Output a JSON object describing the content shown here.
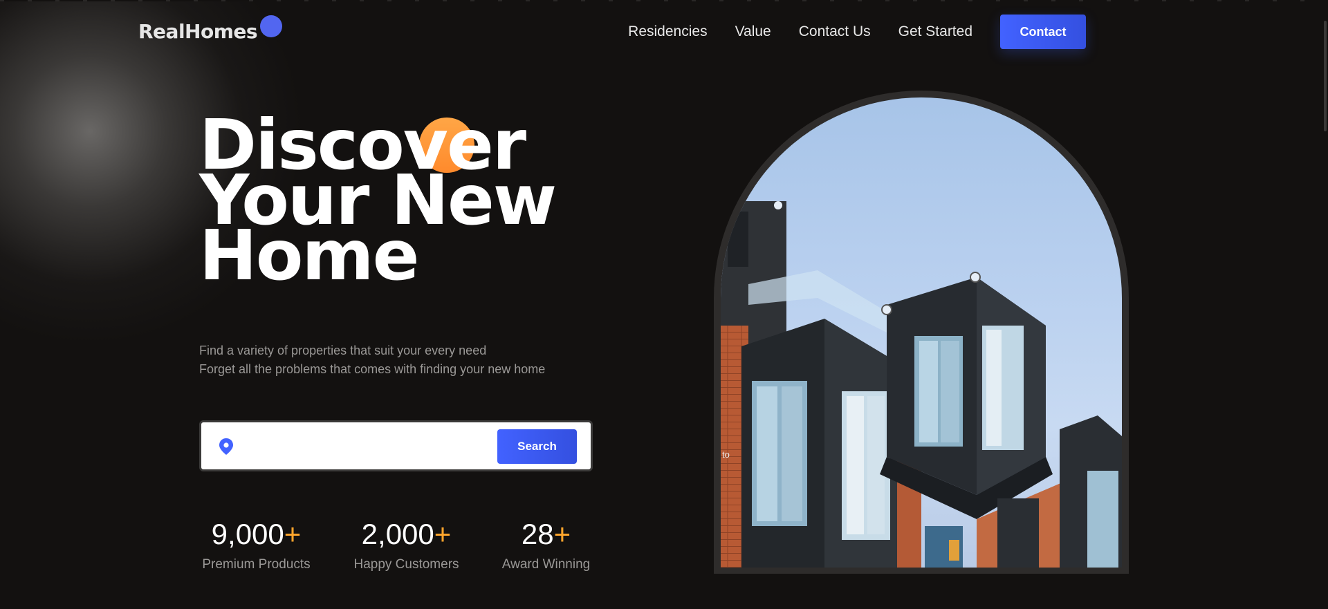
{
  "header": {
    "logo": "RealHomes",
    "nav": [
      {
        "label": "Residencies"
      },
      {
        "label": "Value"
      },
      {
        "label": "Contact Us"
      },
      {
        "label": "Get Started"
      }
    ],
    "cta": "Contact"
  },
  "hero": {
    "title_lines": [
      "Discover",
      "Your New",
      "Home"
    ],
    "subtitle_lines": [
      "Find a variety of properties that suit your every need",
      "Forget all the problems that comes with finding your new home"
    ],
    "search": {
      "value": "",
      "placeholder": "",
      "button": "Search",
      "icon": "location-pin-icon"
    },
    "stats": [
      {
        "value": "9,000",
        "suffix": "+",
        "label": "Premium Products"
      },
      {
        "value": "2,000",
        "suffix": "+",
        "label": "Happy Customers"
      },
      {
        "value": "28",
        "suffix": "+",
        "label": "Award Winning"
      }
    ],
    "image_alt_text": "to"
  },
  "colors": {
    "background": "#131110",
    "accent_blue": "#4262ff",
    "accent_orange": "#ffa52c",
    "muted_text": "#9a9896"
  }
}
